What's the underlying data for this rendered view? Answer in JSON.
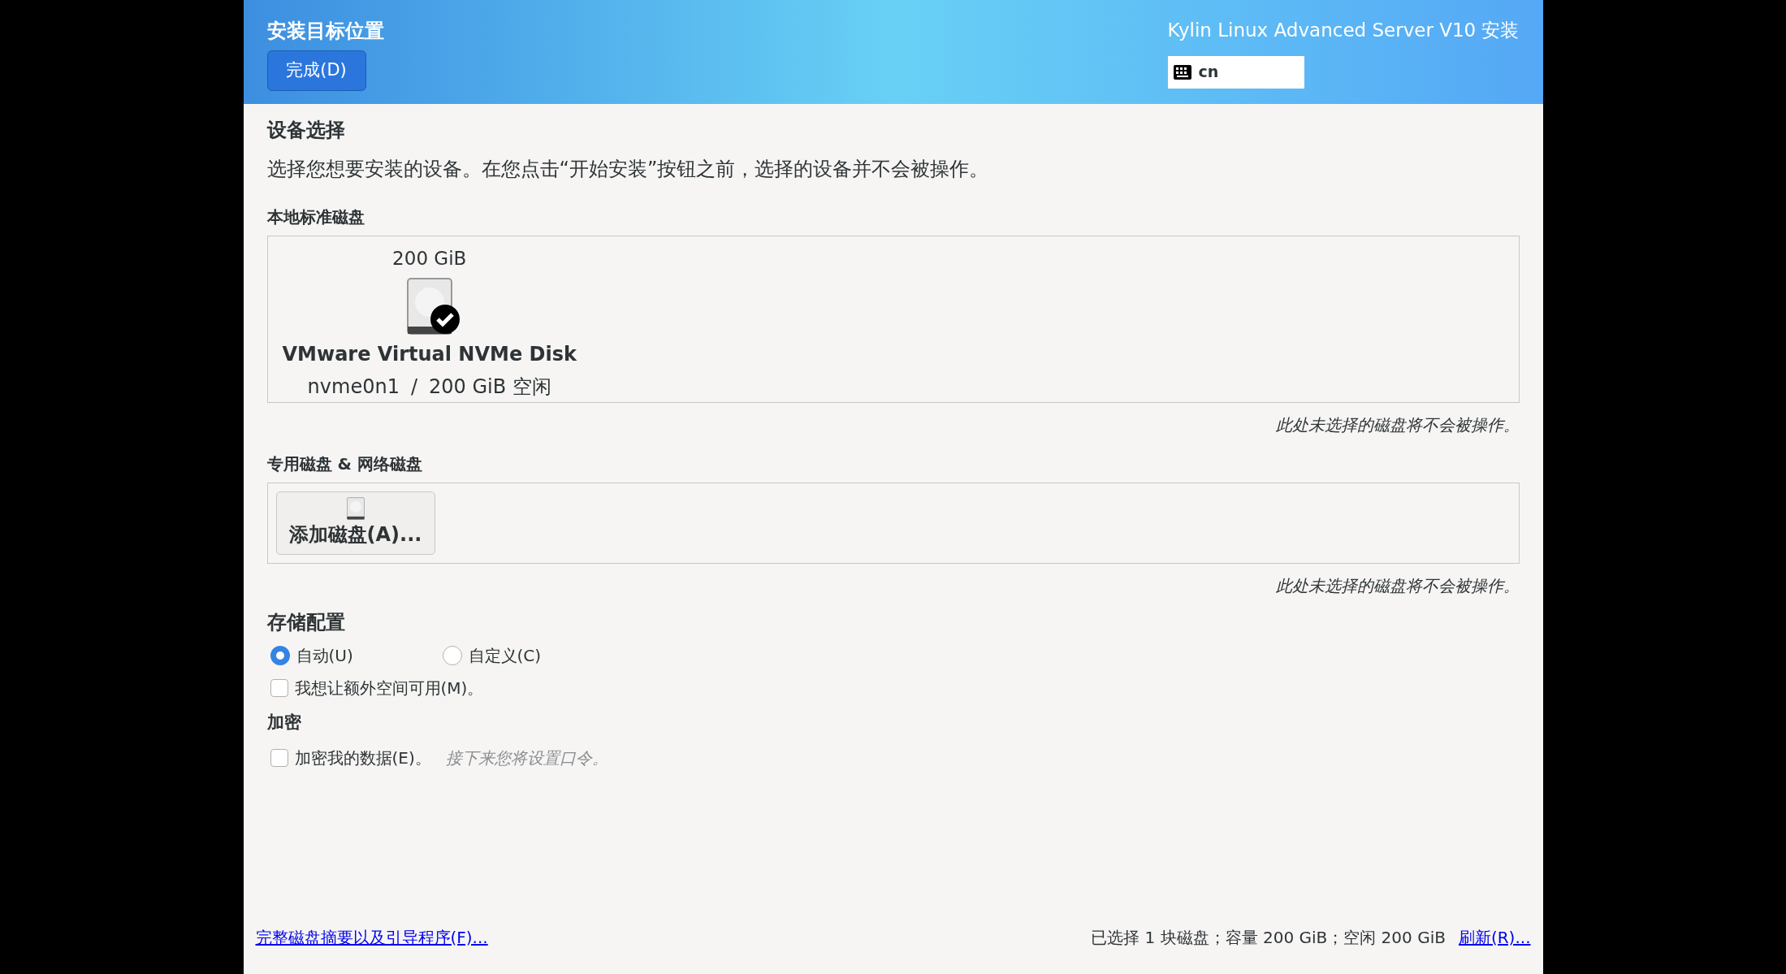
{
  "header": {
    "title": "安装目标位置",
    "done_button": "完成(D)",
    "product": "Kylin Linux Advanced Server V10 安装",
    "keyboard_layout": "cn"
  },
  "device_selection": {
    "title": "设备选择",
    "description": "选择您想要安装的设备。在您点击“开始安装”按钮之前，选择的设备并不会被操作。"
  },
  "local_disks": {
    "title": "本地标准磁盘",
    "disks": [
      {
        "size": "200 GiB",
        "name": "VMware Virtual NVMe Disk",
        "device": "nvme0n1",
        "separator": "/",
        "free": "200 GiB 空闲",
        "selected": true
      }
    ],
    "note": "此处未选择的磁盘将不会被操作。"
  },
  "special_disks": {
    "title": "专用磁盘 & 网络磁盘",
    "add_button": "添加磁盘(A)...",
    "note": "此处未选择的磁盘将不会被操作。"
  },
  "storage_config": {
    "title": "存储配置",
    "options": [
      {
        "label": "自动(U)",
        "selected": true
      },
      {
        "label": "自定义(C)",
        "selected": false
      }
    ],
    "extra_space": {
      "label": "我想让额外空间可用(M)。",
      "checked": false
    }
  },
  "encryption": {
    "title": "加密",
    "encrypt": {
      "label": "加密我的数据(E)。",
      "checked": false
    },
    "hint": "接下来您将设置口令。"
  },
  "footer": {
    "summary_link": "完整磁盘摘要以及引导程序(F)...",
    "status": "已选择 1 块磁盘；容量 200 GiB；空闲 200 GiB",
    "refresh_link": "刷新(R)..."
  }
}
